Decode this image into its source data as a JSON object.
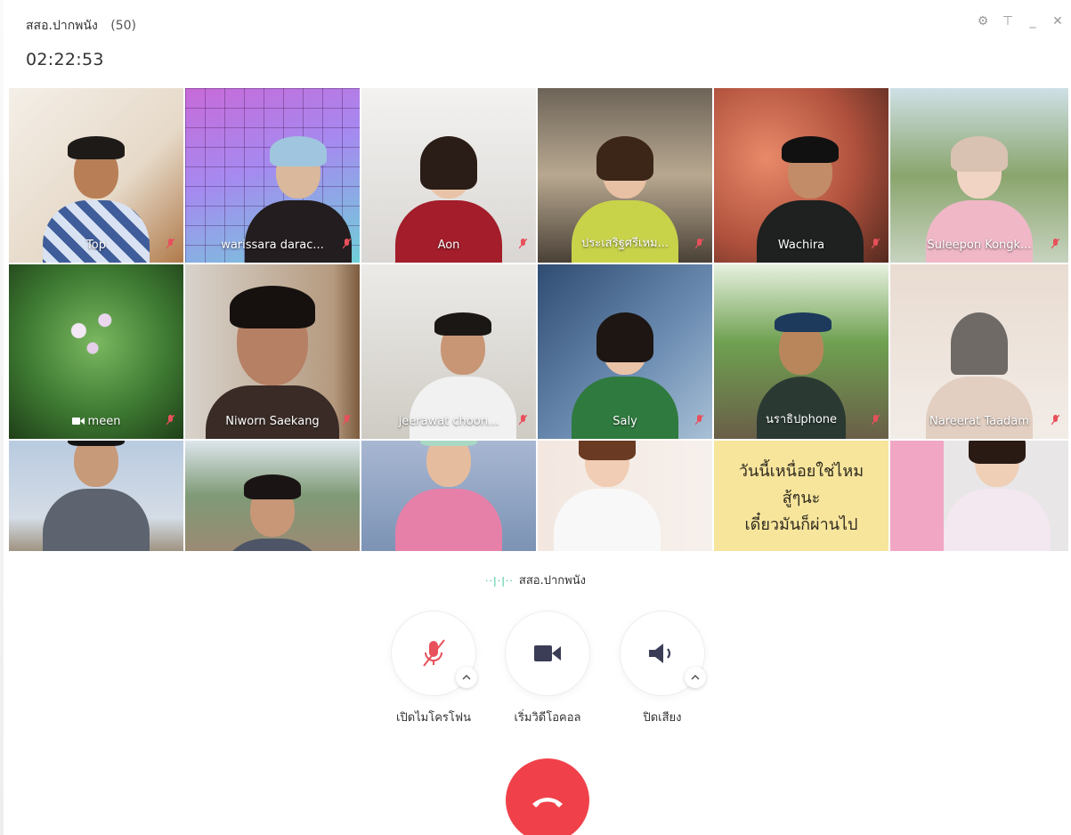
{
  "window": {
    "group_name": "สสอ.ปากพนัง",
    "participant_count": "(50)",
    "elapsed_time": "02:22:53",
    "controls": [
      "settings-icon",
      "pin-icon",
      "minimize-icon",
      "close-icon"
    ]
  },
  "participants": [
    {
      "name": "Top",
      "muted": true
    },
    {
      "name": "warissara darac...",
      "muted": true
    },
    {
      "name": "Aon",
      "muted": true
    },
    {
      "name": "ประเสริฐศรีเหม...",
      "muted": true
    },
    {
      "name": "Wachira",
      "muted": true
    },
    {
      "name": "Suleepon Kongk...",
      "muted": true
    },
    {
      "name": "meen",
      "muted": true,
      "camera_icon": true
    },
    {
      "name": "Niworn Saekang",
      "muted": true
    },
    {
      "name": "jeerawat  choon...",
      "muted": true
    },
    {
      "name": "Saly",
      "muted": true
    },
    {
      "name": "นราธิปphone",
      "muted": true
    },
    {
      "name": "Nareerat Taadam",
      "muted": true
    },
    {
      "name": "",
      "muted": false
    },
    {
      "name": "",
      "muted": false
    },
    {
      "name": "",
      "muted": false
    },
    {
      "name": "",
      "muted": false
    },
    {
      "name": "",
      "muted": false
    },
    {
      "name": "",
      "muted": false
    }
  ],
  "sign_tile": {
    "line1": "วันนี้เหนื่อยใช่ไหม",
    "line2": "สู้ๆนะ",
    "line3": "เดี๋ยวมันก็ผ่านไป"
  },
  "active_speaker": {
    "name": "สสอ.ปากพนัง"
  },
  "call_controls": {
    "mic_label": "เปิดไมโครโฟน",
    "video_label": "เริ่มวิดีโอคอล",
    "speaker_label": "ปิดเสียง"
  },
  "colors": {
    "hangup": "#f0414a",
    "mute_red": "#e8505b",
    "speaking_green": "#34c38f"
  }
}
